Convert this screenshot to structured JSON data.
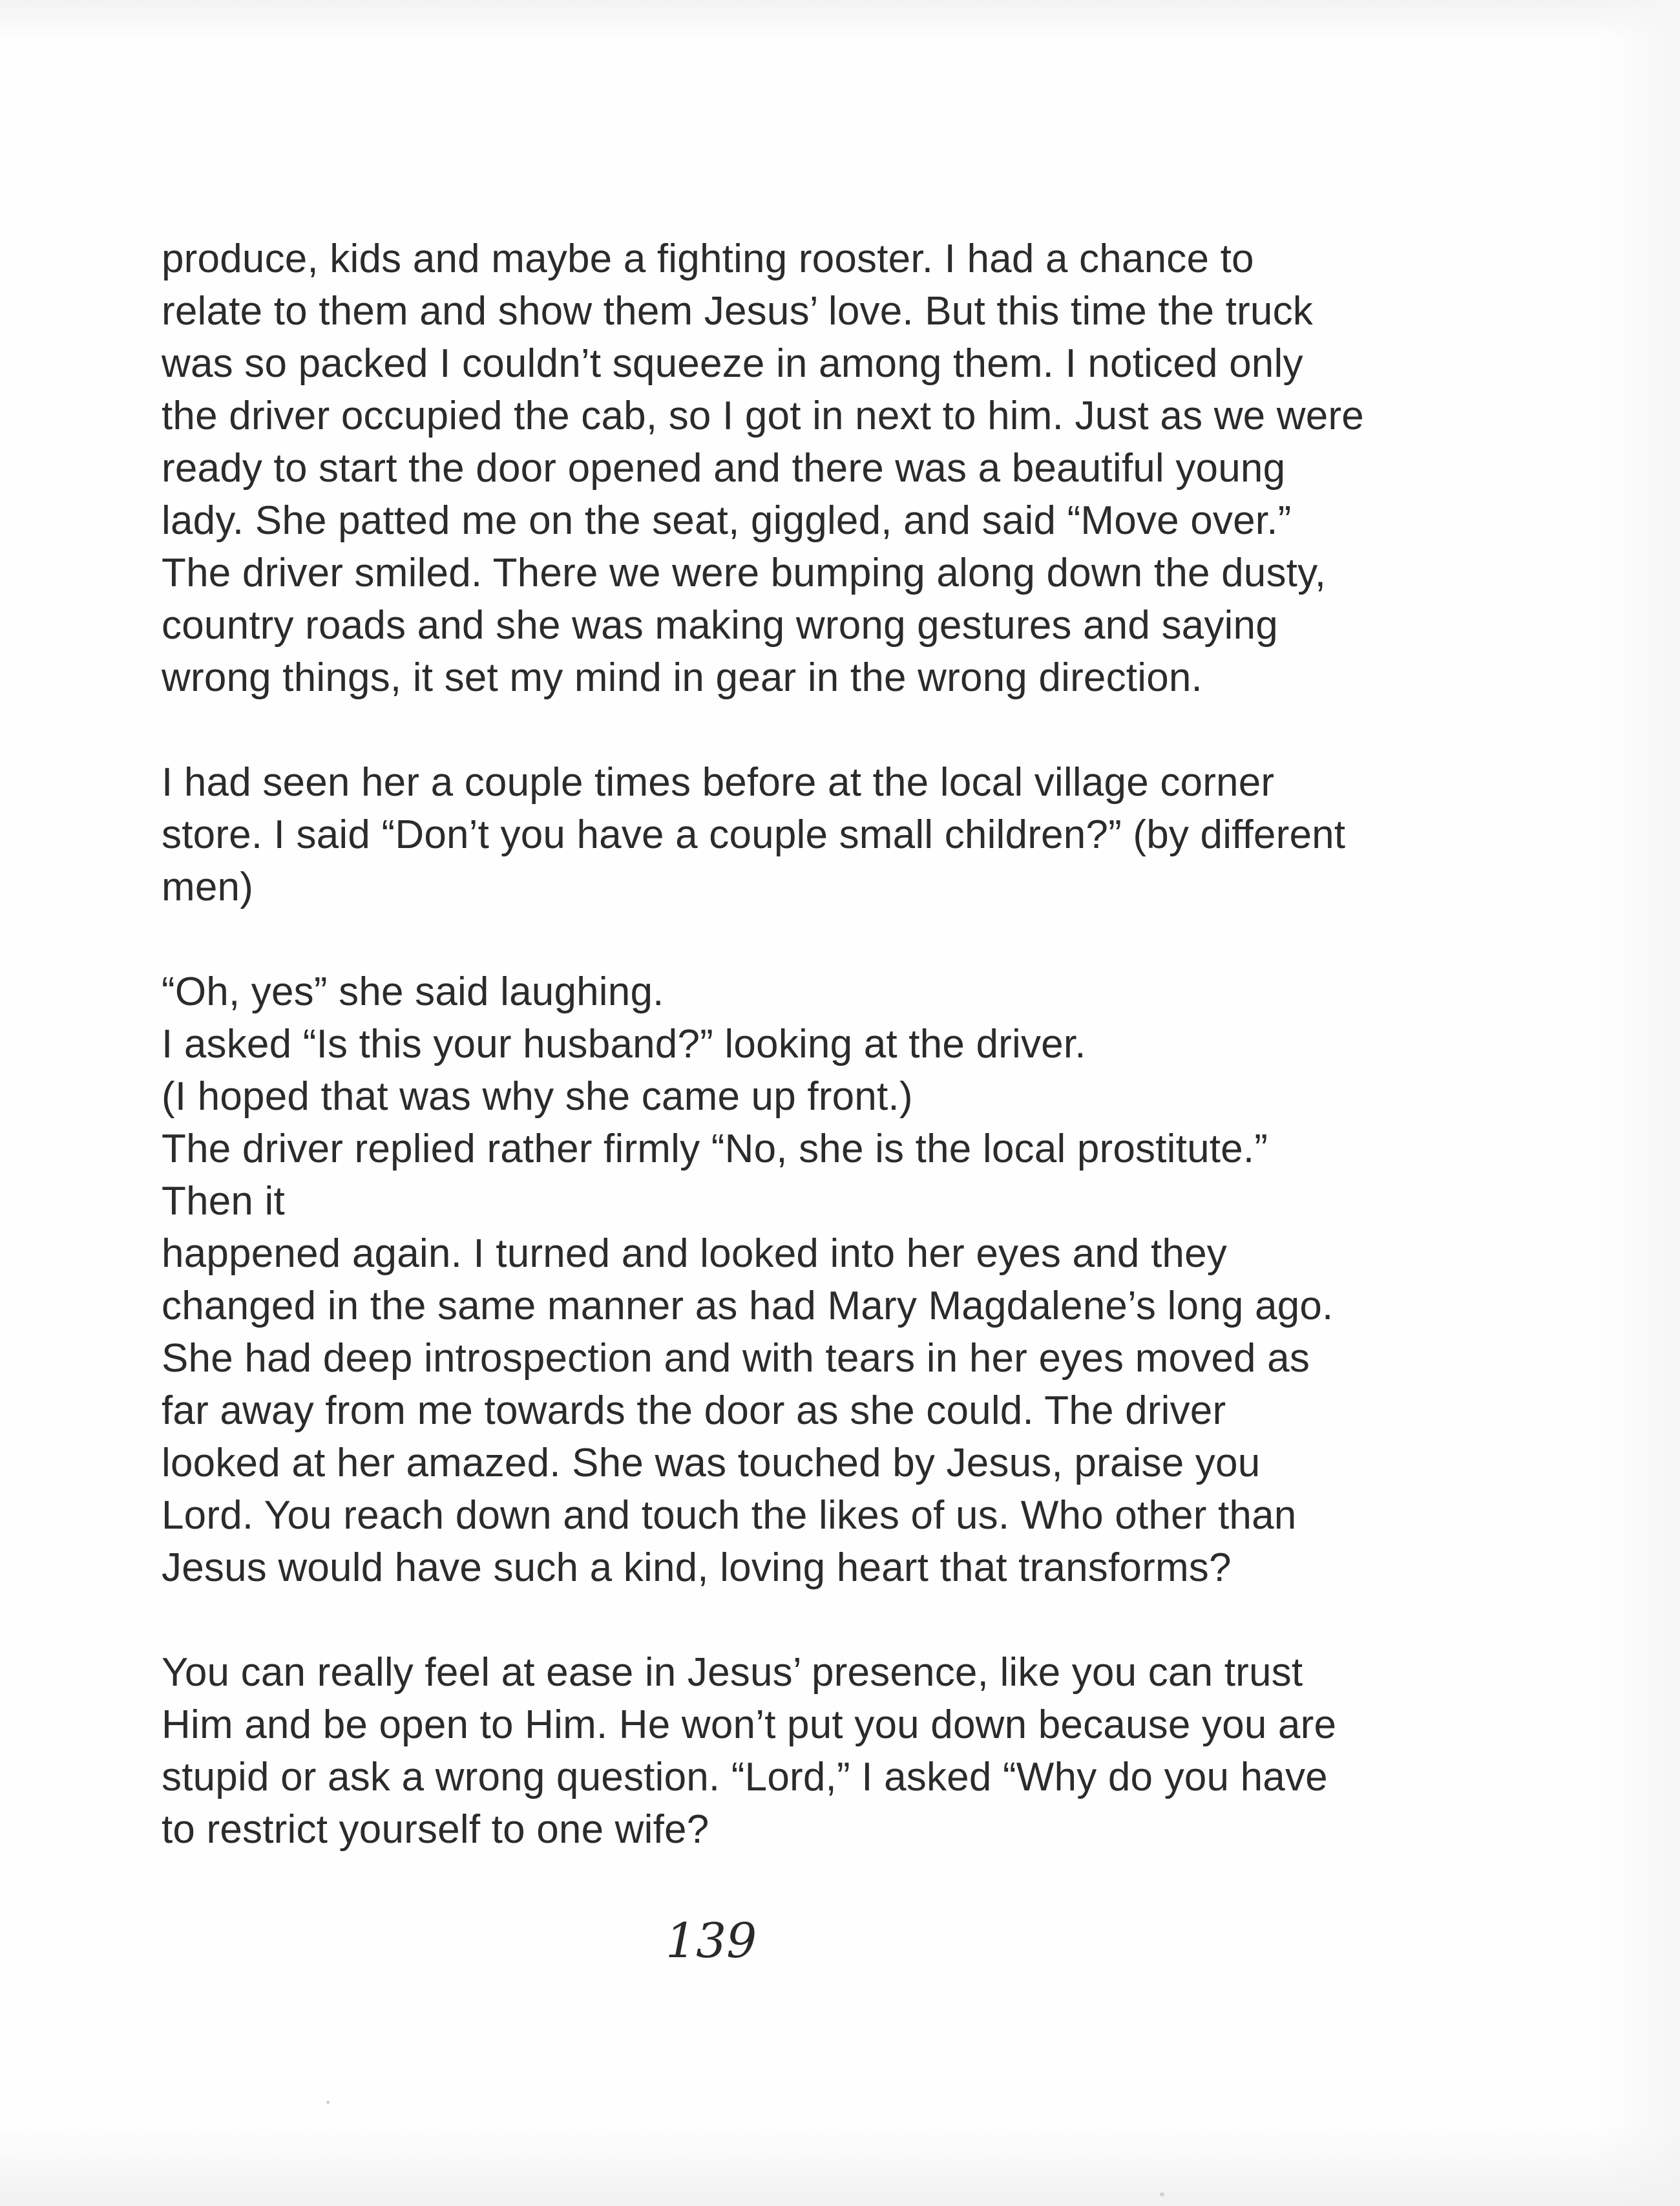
{
  "document": {
    "paragraphs": [
      {
        "lines": [
          "produce, kids and maybe a fighting rooster.  I had a chance to",
          "relate to them and show them Jesus’ love.  But  this time the truck",
          "was so packed I couldn’t squeeze in among them.  I noticed only",
          "the driver occupied the cab, so I got in next to him. Just as we were",
          "ready to start the door opened and  there was a beautiful  young",
          "lady.  She patted me on the seat, giggled, and said “Move over.”",
          "The driver smiled.  There we were bumping along down the dusty,",
          "country roads and she  was making wrong gestures and saying",
          "wrong things, it set my mind in gear  in the wrong direction."
        ]
      },
      {
        "lines": [
          "I had seen her a couple times before at the local village corner",
          "store. I said “Don’t you have a couple small children?”  (by different",
          "men)"
        ]
      },
      {
        "lines": [
          "“Oh, yes” she said laughing.",
          "I asked “Is this your husband?” looking at the driver.",
          "(I hoped that was why she came up front.)",
          "The driver replied rather firmly “No, she is the local prostitute.”",
          "Then it",
          "happened again.  I turned and looked into her eyes and they",
          "changed in the same manner as had Mary Magdalene’s long ago.",
          "She had deep introspection and with tears in her eyes moved as",
          "far away from me towards the door as she could.  The driver",
          "looked at her amazed.  She was touched by Jesus, praise you",
          "Lord.  You reach down and touch the likes of us.  Who other than",
          "Jesus would have such a kind, loving heart that transforms?"
        ]
      },
      {
        "lines": [
          "You can really feel at ease in Jesus’ presence, like you can trust",
          "Him and be open to Him.  He won’t put you down because you are",
          "stupid or ask a wrong question.  “Lord,” I asked “Why do you have",
          "to restrict yourself to one wife?"
        ]
      }
    ],
    "page_number": "139"
  }
}
